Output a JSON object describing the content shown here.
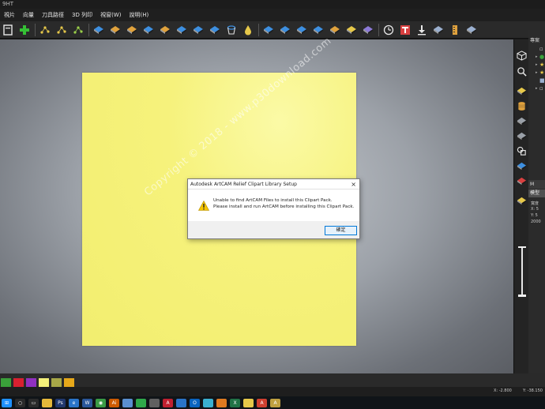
{
  "titlebar": {
    "text": "9HT"
  },
  "menu": [
    "視片",
    "向量",
    "刀具路徑",
    "3D 列印",
    "視窗(W)",
    "說明(H)"
  ],
  "toolbar": {
    "buttons": [
      {
        "name": "new-file-icon",
        "color": "#e8e8e8"
      },
      {
        "name": "add-icon",
        "color": "#35c035"
      },
      {
        "name": "node-edit-icon",
        "color": "#e6c84a"
      },
      {
        "name": "node-points-icon",
        "color": "#e6c84a"
      },
      {
        "name": "spline-icon",
        "color": "#9bd04a"
      },
      {
        "name": "relief-shape-icon",
        "color": "#3d8fe0"
      },
      {
        "name": "relief-dome-icon",
        "color": "#e0a23d"
      },
      {
        "name": "relief-sweep-icon",
        "color": "#e0a23d"
      },
      {
        "name": "relief-extrude-icon",
        "color": "#3d8fe0"
      },
      {
        "name": "relief-merge-icon",
        "color": "#e0a23d"
      },
      {
        "name": "relief-layer-icon",
        "color": "#3d8fe0"
      },
      {
        "name": "relief-texture-icon",
        "color": "#3d8fe0"
      },
      {
        "name": "relief-sculpt-icon",
        "color": "#3d8fe0"
      },
      {
        "name": "cup-icon",
        "color": "#3d8fe0"
      },
      {
        "name": "drop-icon",
        "color": "#e6c84a"
      },
      {
        "name": "relief-blue-icon",
        "color": "#3d8fe0"
      },
      {
        "name": "relief-red-blue-icon",
        "color": "#3d8fe0"
      },
      {
        "name": "relief-arrow-icon",
        "color": "#3d8fe0"
      },
      {
        "name": "relief-flat-icon",
        "color": "#3d8fe0"
      },
      {
        "name": "relief-gold-icon",
        "color": "#e0a23d"
      },
      {
        "name": "relief-gold-plane-icon",
        "color": "#e6c84a"
      },
      {
        "name": "relief-purple-icon",
        "color": "#8c7ad8"
      },
      {
        "name": "clock-icon",
        "color": "#e8e8e8"
      },
      {
        "name": "text-tool-icon",
        "color": "#d84040"
      },
      {
        "name": "download-icon",
        "color": "#e8e8e8"
      },
      {
        "name": "layers-icon",
        "color": "#9bb0d0"
      },
      {
        "name": "ruler-icon",
        "color": "#e0a23d"
      },
      {
        "name": "export-icon",
        "color": "#9bb0d0"
      }
    ]
  },
  "watermark": "Copyright © 2018 - www.p30download.com",
  "dialog": {
    "title": "Autodesk ArtCAM Relief Clipart Library Setup",
    "close_glyph": "×",
    "message_line1": "Unable to find ArtCAM Files to install this Clipart Pack.",
    "message_line2": "Please install and run ArtCAM before installing this Clipart Pack.",
    "ok_label": "確定"
  },
  "side_strip": [
    {
      "name": "view-cube-icon",
      "color": "#e8e8e8"
    },
    {
      "name": "zoom-icon",
      "color": "#e8e8e8"
    },
    {
      "name": "relief-layer-icon",
      "color": "#e6c84a"
    },
    {
      "name": "cylinder-icon",
      "color": "#e0a23d"
    },
    {
      "name": "plane-grey-icon",
      "color": "#9aa0a8"
    },
    {
      "name": "plane-edge-icon",
      "color": "#9aa0a8"
    },
    {
      "name": "shapes-icon",
      "color": "#e8e8e8"
    },
    {
      "name": "relief-blue-icon",
      "color": "#3d8fe0"
    },
    {
      "name": "relief-red-icon",
      "color": "#d84040"
    },
    {
      "name": "relief-yellow-icon",
      "color": "#e6c84a"
    }
  ],
  "right_panel": {
    "title": "專案",
    "tree": [
      {
        "arrow": "",
        "glyph": "▫",
        "color": "#cccccc"
      },
      {
        "arrow": "▸",
        "glyph": "●",
        "color": "#3aa03a"
      },
      {
        "arrow": "▸",
        "glyph": "★",
        "color": "#e6c84a"
      },
      {
        "arrow": "▸",
        "glyph": "★",
        "color": "#e6c84a"
      },
      {
        "arrow": "",
        "glyph": "■",
        "color": "#9bb0d0"
      },
      {
        "arrow": "▸",
        "glyph": "▫",
        "color": "#cccccc"
      }
    ],
    "model_tab": "M",
    "model_header": "模型",
    "props": [
      "寬度",
      "X: 5",
      "Y: 5",
      "2000"
    ]
  },
  "palette": {
    "colors": [
      "#3aa03a",
      "#d82030",
      "#9030c0",
      "#f4f07a",
      "#a8a848",
      "#e6a81a"
    ]
  },
  "status": {
    "x_readout": "X: -2.800",
    "y_readout": "Y: -38.150"
  },
  "taskbar": {
    "items": [
      {
        "name": "start-icon",
        "color": "#1e90ff",
        "glyph": "⊞"
      },
      {
        "name": "search-icon",
        "color": "#2a2a2a",
        "glyph": "○"
      },
      {
        "name": "task-view-icon",
        "color": "#2a2a2a",
        "glyph": "▭"
      },
      {
        "name": "folder-icon",
        "color": "#e6b83a",
        "glyph": ""
      },
      {
        "name": "photoshop-icon",
        "color": "#21386e",
        "glyph": "Ps"
      },
      {
        "name": "ie-icon",
        "color": "#2a74c8",
        "glyph": "e"
      },
      {
        "name": "word-icon",
        "color": "#2b579a",
        "glyph": "W"
      },
      {
        "name": "chrome-icon",
        "color": "#3a9b45",
        "glyph": "◉"
      },
      {
        "name": "illustrator-icon",
        "color": "#cc5a00",
        "glyph": "Ai"
      },
      {
        "name": "notepad-icon",
        "color": "#5a8fd0",
        "glyph": ""
      },
      {
        "name": "green-app-icon",
        "color": "#2fa84a",
        "glyph": ""
      },
      {
        "name": "grey-app-icon",
        "color": "#606060",
        "glyph": ""
      },
      {
        "name": "red-app-icon",
        "color": "#c02030",
        "glyph": "A"
      },
      {
        "name": "blue-app-icon",
        "color": "#2a74c8",
        "glyph": ""
      },
      {
        "name": "outlook-icon",
        "color": "#0a64c0",
        "glyph": "O"
      },
      {
        "name": "cyan-app-icon",
        "color": "#3ab0d0",
        "glyph": ""
      },
      {
        "name": "orange-app-icon",
        "color": "#e07a20",
        "glyph": ""
      },
      {
        "name": "excel-icon",
        "color": "#217346",
        "glyph": "X"
      },
      {
        "name": "yellow-app-icon",
        "color": "#e6c84a",
        "glyph": ""
      },
      {
        "name": "artcam-icon",
        "color": "#d04030",
        "glyph": "A"
      },
      {
        "name": "installer-icon",
        "color": "#c0a040",
        "glyph": "A"
      }
    ]
  }
}
